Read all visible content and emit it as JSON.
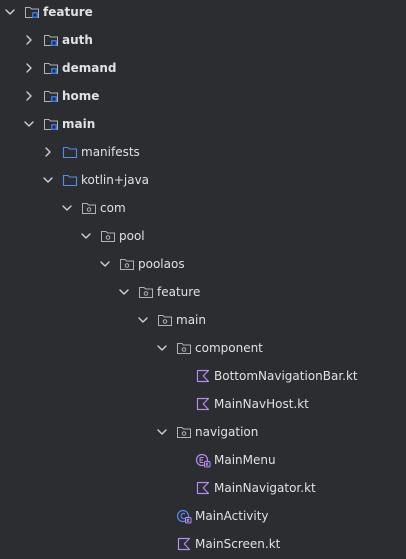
{
  "tree": [
    {
      "label": "feature",
      "depth": 0,
      "expanded": true,
      "icon": "module-folder-icon",
      "bold": true
    },
    {
      "label": "auth",
      "depth": 1,
      "expanded": false,
      "icon": "module-folder-icon",
      "bold": true
    },
    {
      "label": "demand",
      "depth": 1,
      "expanded": false,
      "icon": "module-folder-icon",
      "bold": true
    },
    {
      "label": "home",
      "depth": 1,
      "expanded": false,
      "icon": "module-folder-icon",
      "bold": true
    },
    {
      "label": "main",
      "depth": 1,
      "expanded": true,
      "icon": "module-folder-icon",
      "bold": true
    },
    {
      "label": "manifests",
      "depth": 2,
      "expanded": false,
      "icon": "source-folder-icon",
      "bold": false
    },
    {
      "label": "kotlin+java",
      "depth": 2,
      "expanded": true,
      "icon": "source-folder-icon",
      "bold": false
    },
    {
      "label": "com",
      "depth": 3,
      "expanded": true,
      "icon": "package-icon",
      "bold": false
    },
    {
      "label": "pool",
      "depth": 4,
      "expanded": true,
      "icon": "package-icon",
      "bold": false
    },
    {
      "label": "poolaos",
      "depth": 5,
      "expanded": true,
      "icon": "package-icon",
      "bold": false
    },
    {
      "label": "feature",
      "depth": 6,
      "expanded": true,
      "icon": "package-icon",
      "bold": false
    },
    {
      "label": "main",
      "depth": 7,
      "expanded": true,
      "icon": "package-icon",
      "bold": false
    },
    {
      "label": "component",
      "depth": 8,
      "expanded": true,
      "icon": "package-icon",
      "bold": false
    },
    {
      "label": "BottomNavigationBar.kt",
      "depth": 9,
      "expanded": null,
      "icon": "kotlin-file-icon",
      "bold": false
    },
    {
      "label": "MainNavHost.kt",
      "depth": 9,
      "expanded": null,
      "icon": "kotlin-file-icon",
      "bold": false
    },
    {
      "label": "navigation",
      "depth": 8,
      "expanded": true,
      "icon": "package-icon",
      "bold": false
    },
    {
      "label": "MainMenu",
      "depth": 9,
      "expanded": null,
      "icon": "kotlin-enum-icon",
      "bold": false
    },
    {
      "label": "MainNavigator.kt",
      "depth": 9,
      "expanded": null,
      "icon": "kotlin-file-icon",
      "bold": false
    },
    {
      "label": "MainActivity",
      "depth": 8,
      "expanded": null,
      "icon": "kotlin-class-icon",
      "bold": false
    },
    {
      "label": "MainScreen.kt",
      "depth": 8,
      "expanded": null,
      "icon": "kotlin-file-icon",
      "bold": false
    }
  ],
  "colors": {
    "background": "#2b2d30",
    "text": "#dfe1e5",
    "chevron": "#ced0d6",
    "folder_outline": "#afb1b3",
    "source_folder": "#548af7",
    "kotlin_purple": "#b48cf2",
    "module_badge": "#3574f0"
  }
}
